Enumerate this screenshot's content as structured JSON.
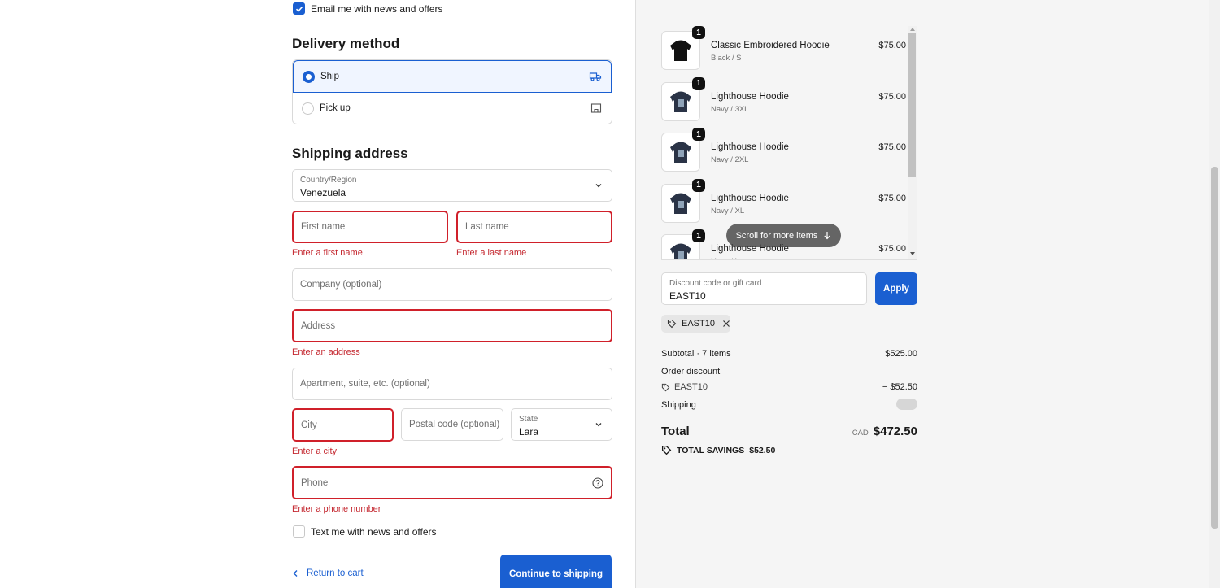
{
  "contact": {
    "email_opt_in_label": "Email me with news and offers",
    "email_opt_in_checked": true
  },
  "delivery": {
    "title": "Delivery method",
    "options": [
      {
        "label": "Ship",
        "selected": true,
        "icon": "truck-icon"
      },
      {
        "label": "Pick up",
        "selected": false,
        "icon": "store-icon"
      }
    ]
  },
  "shipping": {
    "title": "Shipping address",
    "country_label": "Country/Region",
    "country_value": "Venezuela",
    "first_name_placeholder": "First name",
    "first_name_error": "Enter a first name",
    "last_name_placeholder": "Last name",
    "last_name_error": "Enter a last name",
    "company_placeholder": "Company (optional)",
    "address_placeholder": "Address",
    "address_error": "Enter an address",
    "apartment_placeholder": "Apartment, suite, etc. (optional)",
    "city_placeholder": "City",
    "city_error": "Enter a city",
    "postal_placeholder": "Postal code (optional)",
    "state_label": "State",
    "state_value": "Lara",
    "phone_placeholder": "Phone",
    "phone_error": "Enter a phone number",
    "sms_opt_in_label": "Text me with news and offers",
    "sms_opt_in_checked": false
  },
  "footer": {
    "return_label": "Return to cart",
    "continue_label": "Continue to shipping"
  },
  "cart": {
    "items": [
      {
        "name": "Classic Embroidered Hoodie",
        "variant": "Black / S",
        "price": "$75.00",
        "qty": "1",
        "color": "#111111"
      },
      {
        "name": "Lighthouse Hoodie",
        "variant": "Navy / 3XL",
        "price": "$75.00",
        "qty": "1",
        "color": "#2a3346"
      },
      {
        "name": "Lighthouse Hoodie",
        "variant": "Navy / 2XL",
        "price": "$75.00",
        "qty": "1",
        "color": "#2a3346"
      },
      {
        "name": "Lighthouse Hoodie",
        "variant": "Navy / XL",
        "price": "$75.00",
        "qty": "1",
        "color": "#2a3346"
      },
      {
        "name": "Lighthouse Hoodie",
        "variant": "Navy / L",
        "price": "$75.00",
        "qty": "1",
        "color": "#2a3346"
      }
    ],
    "scroll_hint": "Scroll for more items"
  },
  "discount": {
    "label": "Discount code or gift card",
    "value": "EAST10",
    "apply_label": "Apply",
    "applied_code": "EAST10"
  },
  "summary": {
    "subtotal_label": "Subtotal · 7 items",
    "subtotal_value": "$525.00",
    "order_discount_label": "Order discount",
    "discount_code": "EAST10",
    "discount_value": "− $52.50",
    "shipping_label": "Shipping",
    "total_label": "Total",
    "currency": "CAD",
    "total_value": "$472.50",
    "savings_label": "TOTAL SAVINGS",
    "savings_value": "$52.50"
  },
  "colors": {
    "accent": "#1a5fd1",
    "error": "#d0202a"
  }
}
